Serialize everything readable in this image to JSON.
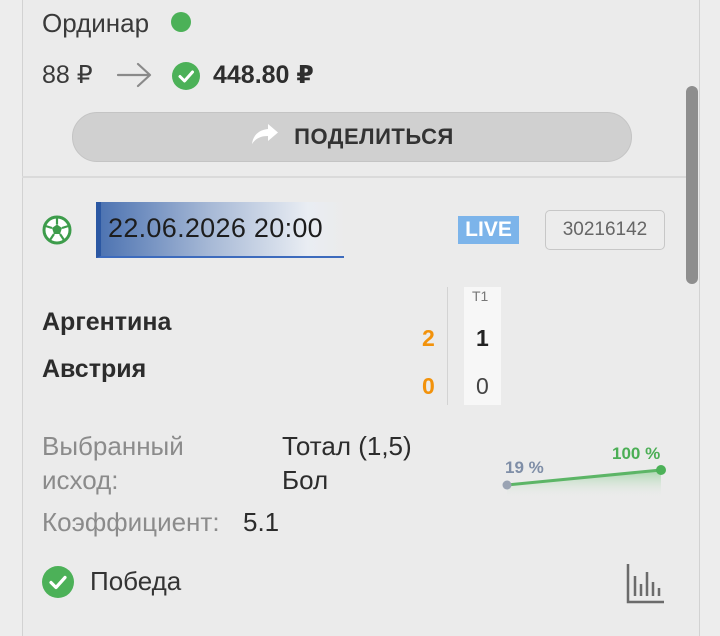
{
  "bet": {
    "type_label": "Ординар",
    "stake": "88 ₽",
    "win_amount": "448.80 ₽",
    "share_label": "ПОДЕЛИТЬСЯ"
  },
  "event": {
    "datetime": "22.06.2026 20:00",
    "live_badge": "LIVE",
    "event_id": "30216142",
    "period_header": "T1",
    "teams": [
      {
        "name": "Аргентина",
        "total": "2",
        "period": "1"
      },
      {
        "name": "Австрия",
        "total": "0",
        "period": "0"
      }
    ]
  },
  "outcome": {
    "selected_label_line1": "Выбранный",
    "selected_label_line2": "исход:",
    "selected_value_line1": "Тотал (1,5)",
    "selected_value_line2": "Бол",
    "coef_label": "Коэффициент:",
    "coef_value": "5.1",
    "pct_start": "19 %",
    "pct_end": "100 %",
    "result_label": "Победа"
  },
  "colors": {
    "green": "#4cb158",
    "live_badge": "#7cb4ea",
    "score_orange": "#f2920b",
    "date_accent": "#2b57a2"
  },
  "icons": {
    "status": "green-dot-icon",
    "arrow": "arrow-right-icon",
    "check": "check-circle-icon",
    "share": "share-icon",
    "sport": "soccer-ball-icon",
    "stats": "bar-chart-icon"
  }
}
